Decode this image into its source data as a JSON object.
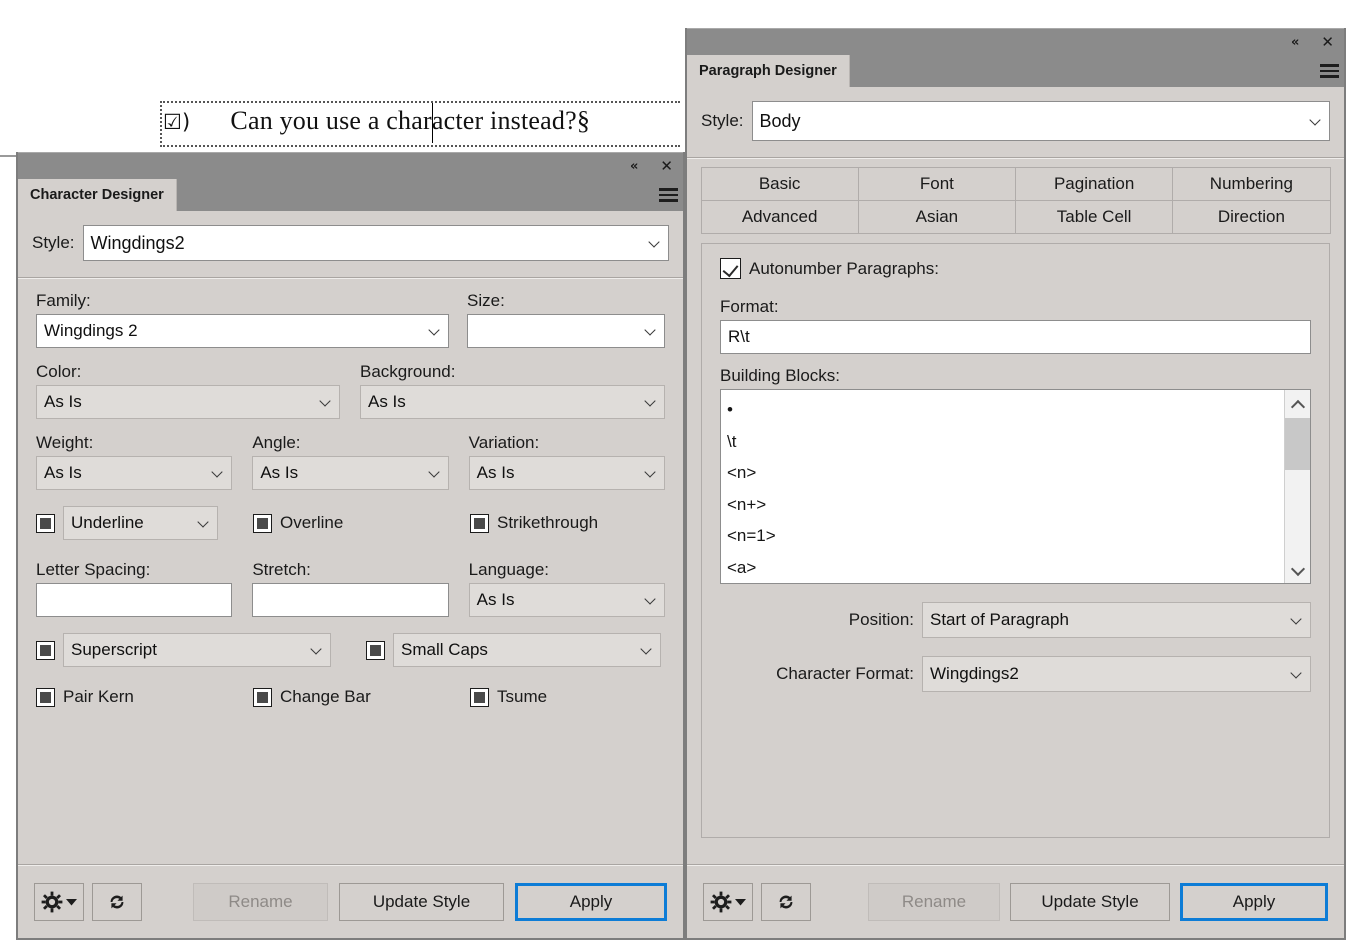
{
  "document": {
    "line_text_prefix": "☑)",
    "line_text": "Can you use a character instead?§"
  },
  "character_designer": {
    "title": "Character Designer",
    "tab_label": "Character Designer",
    "titlebar": {
      "collapse_icon": "«",
      "close_icon": "✕",
      "menu_icon": "hamburger-icon"
    },
    "style": {
      "label": "Style:",
      "value": "Wingdings2"
    },
    "family": {
      "label": "Family:",
      "value": "Wingdings 2"
    },
    "size": {
      "label": "Size:",
      "value": ""
    },
    "color": {
      "label": "Color:",
      "value": "As Is"
    },
    "background": {
      "label": "Background:",
      "value": "As Is"
    },
    "weight": {
      "label": "Weight:",
      "value": "As Is"
    },
    "angle": {
      "label": "Angle:",
      "value": "As Is"
    },
    "variation": {
      "label": "Variation:",
      "value": "As Is"
    },
    "underline": {
      "value": "Underline"
    },
    "overline": {
      "label": "Overline"
    },
    "strikethrough": {
      "label": "Strikethrough"
    },
    "letter_spacing": {
      "label": "Letter Spacing:",
      "value": ""
    },
    "stretch": {
      "label": "Stretch:",
      "value": ""
    },
    "language": {
      "label": "Language:",
      "value": "As Is"
    },
    "superscript": {
      "value": "Superscript"
    },
    "small_caps": {
      "value": "Small Caps"
    },
    "pair_kern": {
      "label": "Pair Kern"
    },
    "change_bar": {
      "label": "Change Bar"
    },
    "tsume": {
      "label": "Tsume"
    },
    "buttons": {
      "gear": "gear-dropdown-button",
      "refresh": "refresh-button",
      "rename": "Rename",
      "update_style": "Update Style",
      "apply": "Apply"
    }
  },
  "paragraph_designer": {
    "title": "Paragraph Designer",
    "tab_label": "Paragraph Designer",
    "titlebar": {
      "collapse_icon": "«",
      "close_icon": "✕",
      "menu_icon": "hamburger-icon"
    },
    "style": {
      "label": "Style:",
      "value": "Body"
    },
    "tabs": [
      {
        "label": "Basic",
        "active": false
      },
      {
        "label": "Font",
        "active": false
      },
      {
        "label": "Pagination",
        "active": false
      },
      {
        "label": "Numbering",
        "active": true
      },
      {
        "label": "Advanced",
        "active": false
      },
      {
        "label": "Asian",
        "active": false
      },
      {
        "label": "Table Cell",
        "active": false
      },
      {
        "label": "Direction",
        "active": false
      }
    ],
    "numbering": {
      "autonumber": {
        "label": "Autonumber Paragraphs:",
        "checked": true
      },
      "format": {
        "label": "Format:",
        "value": "R\\t"
      },
      "building_blocks": {
        "label": "Building Blocks:",
        "items": [
          "•",
          "\\t",
          "<n>",
          "<n+>",
          "<n=1>",
          "<a>"
        ]
      },
      "position": {
        "label": "Position:",
        "value": "Start of Paragraph"
      },
      "character_format": {
        "label": "Character Format:",
        "value": "Wingdings2"
      }
    },
    "buttons": {
      "gear": "gear-dropdown-button",
      "refresh": "refresh-button",
      "rename": "Rename",
      "update_style": "Update Style",
      "apply": "Apply"
    }
  },
  "colors": {
    "panel_bg": "#d4d0cd",
    "titlebar": "#8b8b8b",
    "accent_blue": "#0d7cd6",
    "field_bg": "#ffffff",
    "disabled_text": "#8e8a87"
  }
}
